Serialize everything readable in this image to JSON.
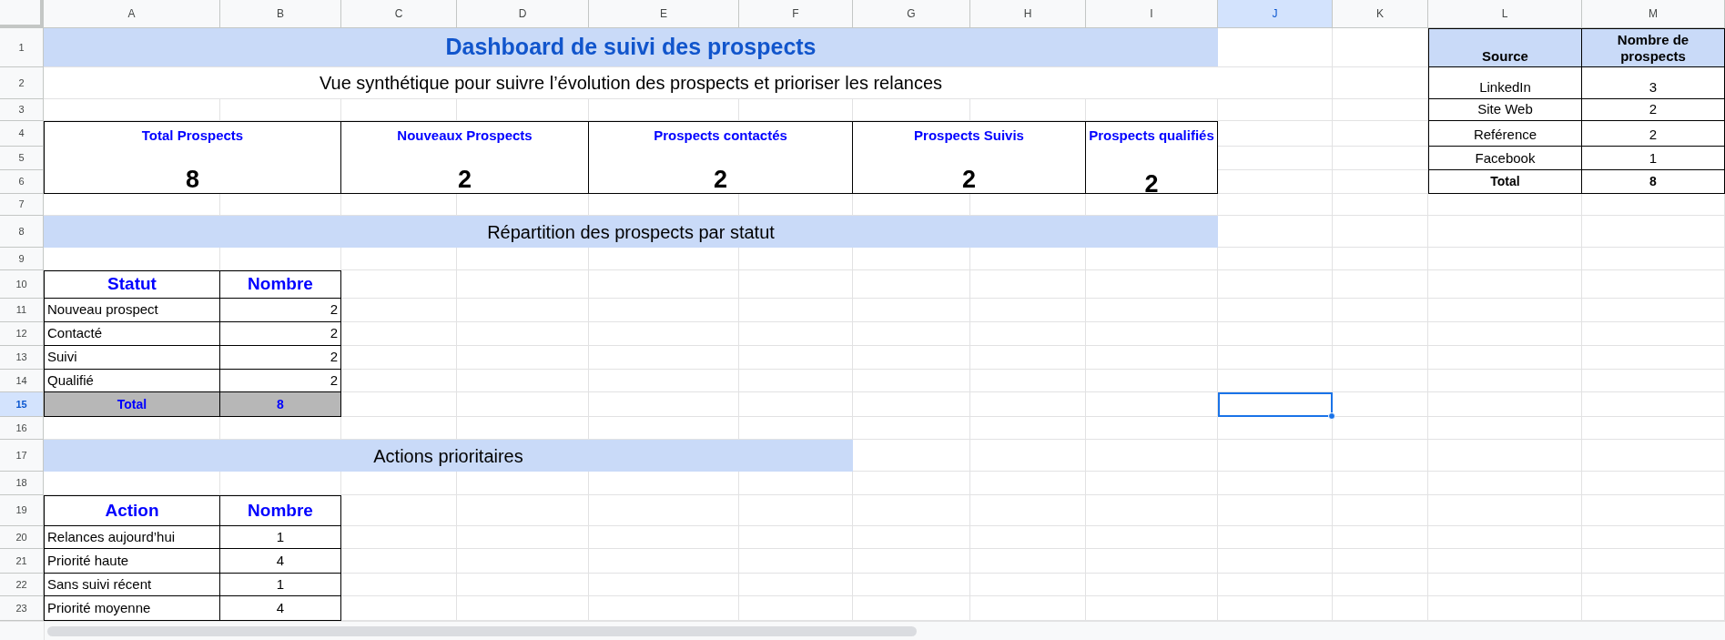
{
  "column_headers": [
    {
      "label": "A",
      "selected": false
    },
    {
      "label": "B",
      "selected": false
    },
    {
      "label": "C",
      "selected": false
    },
    {
      "label": "D",
      "selected": false
    },
    {
      "label": "E",
      "selected": false
    },
    {
      "label": "F",
      "selected": false
    },
    {
      "label": "G",
      "selected": false
    },
    {
      "label": "H",
      "selected": false
    },
    {
      "label": "I",
      "selected": false
    },
    {
      "label": "J",
      "selected": true
    },
    {
      "label": "K",
      "selected": false
    },
    {
      "label": "L",
      "selected": false
    },
    {
      "label": "M",
      "selected": false
    }
  ],
  "row_headers": [
    {
      "label": "1",
      "selected": false
    },
    {
      "label": "2",
      "selected": false
    },
    {
      "label": "3",
      "selected": false
    },
    {
      "label": "4",
      "selected": false
    },
    {
      "label": "5",
      "selected": false
    },
    {
      "label": "6",
      "selected": false
    },
    {
      "label": "7",
      "selected": false
    },
    {
      "label": "8",
      "selected": false
    },
    {
      "label": "9",
      "selected": false
    },
    {
      "label": "10",
      "selected": false
    },
    {
      "label": "11",
      "selected": false
    },
    {
      "label": "12",
      "selected": false
    },
    {
      "label": "13",
      "selected": false
    },
    {
      "label": "14",
      "selected": false
    },
    {
      "label": "15",
      "selected": true
    },
    {
      "label": "16",
      "selected": false
    },
    {
      "label": "17",
      "selected": false
    },
    {
      "label": "18",
      "selected": false
    },
    {
      "label": "19",
      "selected": false
    },
    {
      "label": "20",
      "selected": false
    },
    {
      "label": "21",
      "selected": false
    },
    {
      "label": "22",
      "selected": false
    },
    {
      "label": "23",
      "selected": false
    }
  ],
  "title": "Dashboard de suivi des prospects",
  "subtitle": "Vue synthétique pour suivre l’évolution des prospects et prioriser les relances",
  "kpis": [
    {
      "label": "Total Prospects",
      "value": "8"
    },
    {
      "label": "Nouveaux Prospects",
      "value": "2"
    },
    {
      "label": "Prospects contactés",
      "value": "2"
    },
    {
      "label": "Prospects Suivis",
      "value": "2"
    },
    {
      "label": "Prospects qualifiés",
      "value": "2"
    }
  ],
  "status_section": {
    "title": "Répartition des prospects par statut",
    "columns": [
      "Statut",
      "Nombre"
    ],
    "rows": [
      {
        "label": "Nouveau prospect",
        "value": "2"
      },
      {
        "label": "Contacté",
        "value": "2"
      },
      {
        "label": "Suivi",
        "value": "2"
      },
      {
        "label": "Qualifié",
        "value": "2"
      }
    ],
    "total": {
      "label": "Total",
      "value": "8"
    }
  },
  "actions_section": {
    "title": "Actions prioritaires",
    "columns": [
      "Action",
      "Nombre"
    ],
    "rows": [
      {
        "label": "Relances aujourd’hui",
        "value": "1"
      },
      {
        "label": "Priorité haute",
        "value": "4"
      },
      {
        "label": "Sans suivi récent",
        "value": "1"
      },
      {
        "label": "Priorité moyenne",
        "value": "4"
      }
    ]
  },
  "source_table": {
    "columns": [
      "Source",
      "Nombre de prospects"
    ],
    "rows": [
      {
        "label": "LinkedIn",
        "value": "3"
      },
      {
        "label": "Site Web",
        "value": "2"
      },
      {
        "label": "Reférence",
        "value": "2"
      },
      {
        "label": "Facebook",
        "value": "1"
      }
    ],
    "total": {
      "label": "Total",
      "value": "8"
    }
  }
}
